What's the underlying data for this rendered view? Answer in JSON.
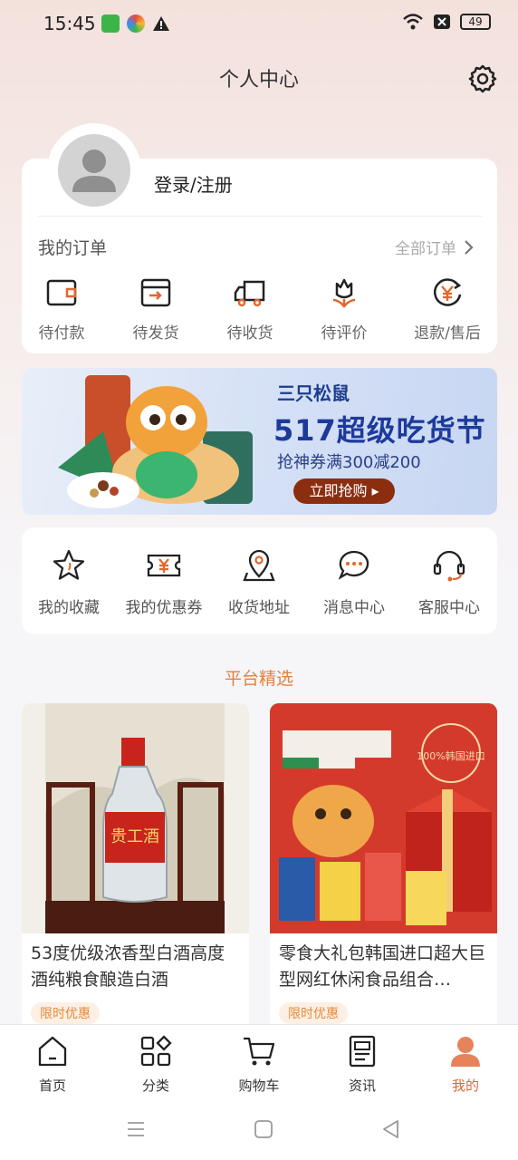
{
  "status_bar": {
    "time": "15:45",
    "battery": "49"
  },
  "header": {
    "title": "个人中心",
    "settings_icon": "gear-icon"
  },
  "profile": {
    "login_text": "登录/注册",
    "avatar_icon": "user-icon"
  },
  "orders": {
    "title": "我的订单",
    "all_label": "全部订单",
    "items": [
      {
        "label": "待付款",
        "icon": "wallet-icon"
      },
      {
        "label": "待发货",
        "icon": "box-arrow-icon"
      },
      {
        "label": "待收货",
        "icon": "truck-icon"
      },
      {
        "label": "待评价",
        "icon": "flower-icon"
      },
      {
        "label": "退款/售后",
        "icon": "yen-refund-icon"
      }
    ]
  },
  "banner": {
    "brand": "三只松鼠",
    "headline": "517超级吃货节",
    "subtitle": "抢神券满300减200",
    "cta": "立即抢购 ▸"
  },
  "services": [
    {
      "label": "我的收藏",
      "icon": "star-icon"
    },
    {
      "label": "我的优惠券",
      "icon": "coupon-icon"
    },
    {
      "label": "收货地址",
      "icon": "location-icon"
    },
    {
      "label": "消息中心",
      "icon": "chat-icon"
    },
    {
      "label": "客服中心",
      "icon": "headset-icon"
    }
  ],
  "section_title": "平台精选",
  "products": [
    {
      "name": "53度优级浓香型白酒高度酒纯粮食酿造白酒",
      "tag": "限时优惠",
      "label_text": "贵工酒"
    },
    {
      "name": "零食大礼包韩国进口超大巨型网红休闲食品组合…",
      "tag": "限时优惠",
      "label_text": "100%韩国进口"
    }
  ],
  "tabs": [
    {
      "label": "首页",
      "icon": "home-icon"
    },
    {
      "label": "分类",
      "icon": "category-icon"
    },
    {
      "label": "购物车",
      "icon": "cart-icon"
    },
    {
      "label": "资讯",
      "icon": "news-icon"
    },
    {
      "label": "我的",
      "icon": "profile-icon",
      "active": true
    }
  ],
  "colors": {
    "accent": "#e2672e",
    "section": "#e2813e",
    "banner_text": "#1d3a9b"
  }
}
